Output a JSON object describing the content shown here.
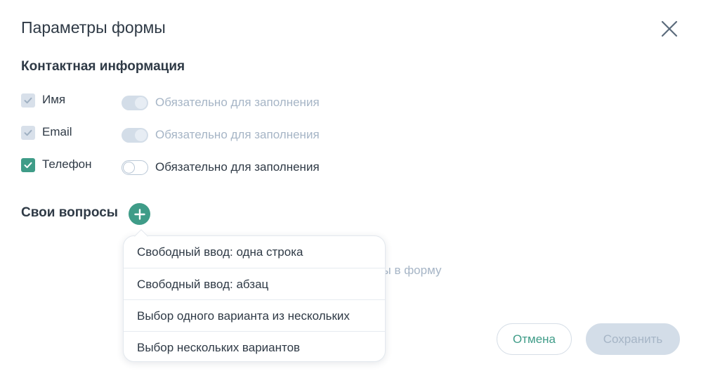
{
  "modal": {
    "title": "Параметры формы"
  },
  "contacts": {
    "heading": "Контактная информация",
    "fields": [
      {
        "label": "Имя",
        "checked": true,
        "disabled": true,
        "required_label": "Обязательно для заполнения",
        "required_on": true,
        "required_disabled": true
      },
      {
        "label": "Email",
        "checked": true,
        "disabled": true,
        "required_label": "Обязательно для заполнения",
        "required_on": true,
        "required_disabled": true
      },
      {
        "label": "Телефон",
        "checked": true,
        "disabled": false,
        "required_label": "Обязательно для заполнения",
        "required_on": false,
        "required_disabled": false
      }
    ]
  },
  "questions": {
    "heading": "Свои вопросы",
    "hint_visible_fragment": "сы в форму"
  },
  "dropdown": {
    "items": [
      "Свободный ввод: одна строка",
      "Свободный ввод: абзац",
      "Выбор одного варианта из нескольких",
      "Выбор нескольких вариантов"
    ]
  },
  "footer": {
    "cancel_label": "Отмена",
    "save_label": "Сохранить"
  },
  "colors": {
    "accent": "#3f9c88",
    "disabled": "#d3dde8",
    "muted_text": "#a6b5c6",
    "text": "#2f3a46"
  }
}
